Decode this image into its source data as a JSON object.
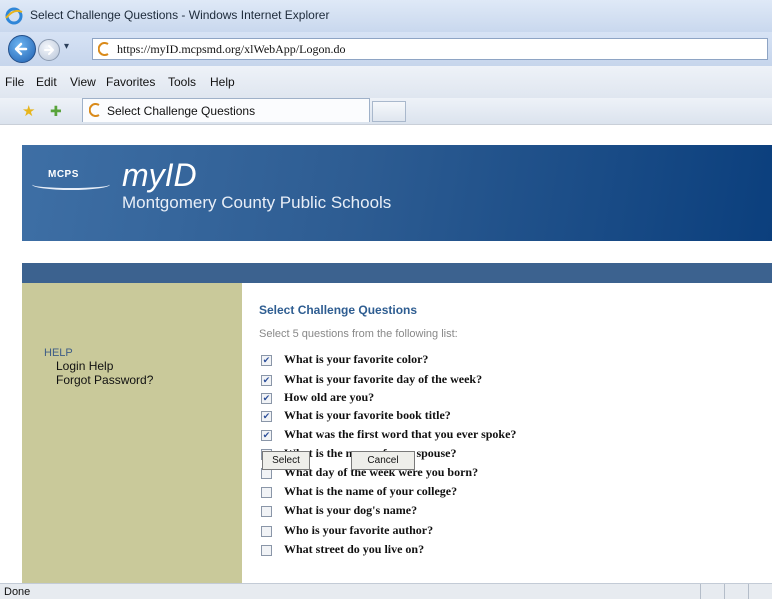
{
  "window": {
    "title": "Select Challenge Questions - Windows Internet Explorer",
    "url": "https://myID.mcpsmd.org/xlWebApp/Logon.do",
    "tab_label": "Select Challenge Questions",
    "status": "Done"
  },
  "menu": [
    "File",
    "Edit",
    "View",
    "Favorites",
    "Tools",
    "Help"
  ],
  "banner": {
    "logo_text": "MCPS",
    "app_name": "myID",
    "org_name": "Montgomery County Public Schools"
  },
  "sidebar": {
    "heading": "HELP",
    "links": [
      "Login Help",
      "Forgot Password?"
    ]
  },
  "main": {
    "title": "Select Challenge Questions",
    "instructions": "Select 5 questions from the following list:",
    "questions": [
      {
        "label": "What is your favorite color?",
        "checked": true
      },
      {
        "label": "What is your favorite day of the week?",
        "checked": true
      },
      {
        "label": "How old are you?",
        "checked": true
      },
      {
        "label": "What is your favorite book title?",
        "checked": true
      },
      {
        "label": "What was the first word that you ever spoke?",
        "checked": true
      },
      {
        "label": "What is the name of your spouse?",
        "checked": false
      },
      {
        "label": "What day of the week were you born?",
        "checked": false
      },
      {
        "label": "What is the name of your college?",
        "checked": false
      },
      {
        "label": "What is your dog's name?",
        "checked": false
      },
      {
        "label": "Who is your favorite author?",
        "checked": false
      },
      {
        "label": "What street do you live on?",
        "checked": false
      }
    ],
    "select_label": "Select",
    "cancel_label": "Cancel"
  },
  "icons": {
    "browser": "ie-logo-icon",
    "back": "back-arrow-icon",
    "forward": "forward-arrow-icon",
    "page": "page-icon",
    "favorites": "favorites-star-icon",
    "add_favorite": "add-favorite-icon"
  },
  "colors": {
    "banner": "#2d5c92",
    "bluebar": "#3c628f",
    "sidebar": "#c9c99a",
    "heading": "#2e5d91"
  }
}
